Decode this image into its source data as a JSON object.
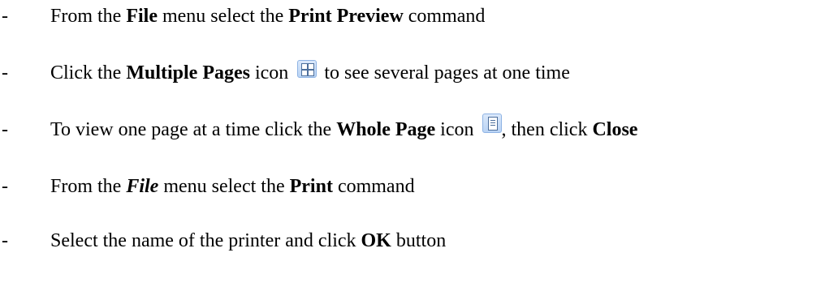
{
  "bullet_marker": "-",
  "steps": [
    {
      "parts": [
        "From the ",
        "File",
        " menu select the ",
        "Print Preview",
        " command"
      ]
    },
    {
      "parts": [
        "Click the ",
        "Multiple Pages",
        " icon ",
        " to see several pages at one time"
      ],
      "icon": "multiple-pages-icon"
    },
    {
      "parts": [
        "To view one page at a time click the ",
        "Whole Page",
        " icon ",
        ", then click ",
        "Close"
      ],
      "icon": "whole-page-icon"
    },
    {
      "parts": [
        "From the ",
        "File",
        " menu select the ",
        "Print",
        " command"
      ]
    },
    {
      "parts": [
        "Select the name of the printer and click ",
        "OK",
        " button"
      ]
    }
  ],
  "colors": {
    "icon_fill": "#b9d3f4",
    "icon_border": "#8eb3e4",
    "icon_glyph": "#4d6f9c"
  }
}
